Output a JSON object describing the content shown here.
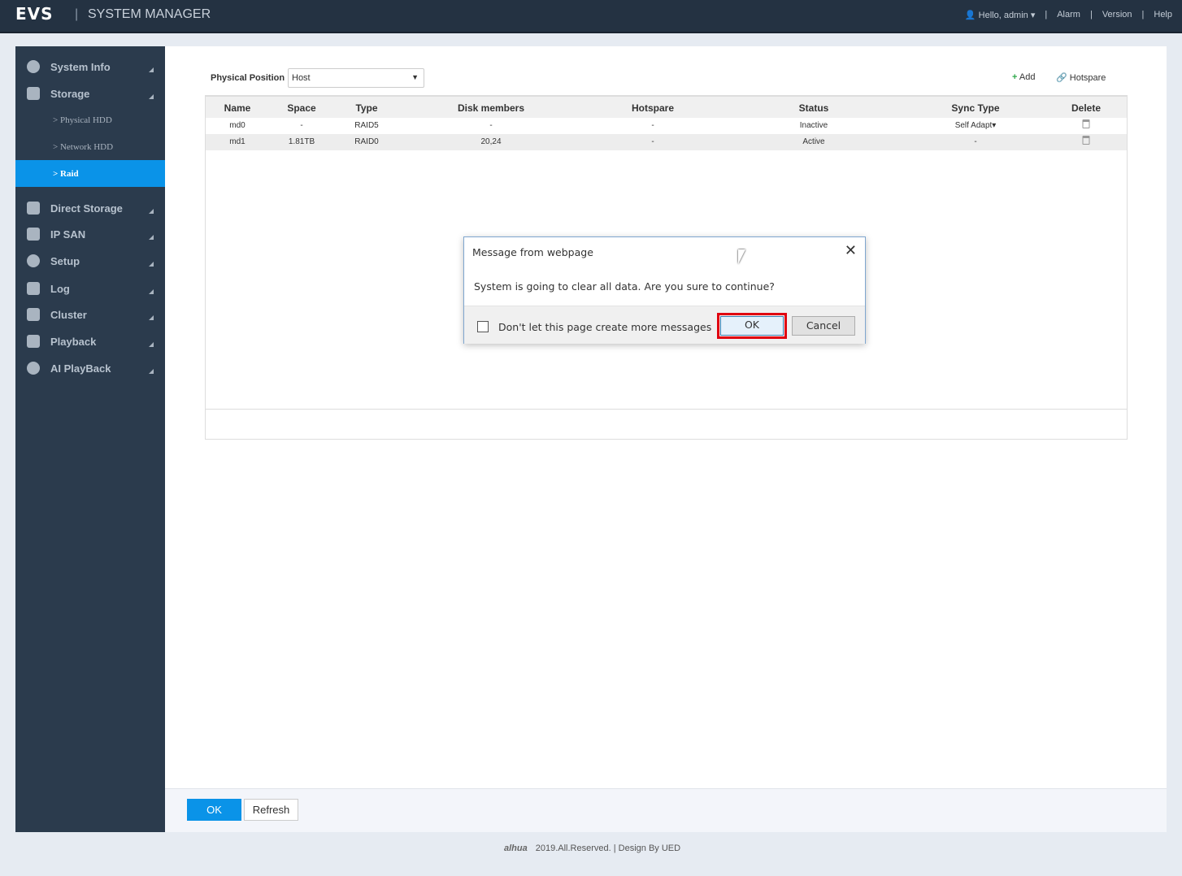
{
  "header": {
    "logo": "EVS",
    "title": "SYSTEM MANAGER",
    "user": "Hello, admin",
    "links": [
      "Alarm",
      "Version",
      "Help"
    ]
  },
  "sidebar": {
    "items": [
      {
        "label": "System Info",
        "icon": "pie-chart-icon"
      },
      {
        "label": "Storage",
        "icon": "floppy-icon"
      },
      {
        "label": "Direct Storage",
        "icon": "direct-storage-icon"
      },
      {
        "label": "IP SAN",
        "icon": "server-icon"
      },
      {
        "label": "Setup",
        "icon": "gear-icon"
      },
      {
        "label": "Log",
        "icon": "log-icon"
      },
      {
        "label": "Cluster",
        "icon": "cluster-icon"
      },
      {
        "label": "Playback",
        "icon": "playback-icon"
      },
      {
        "label": "AI PlayBack",
        "icon": "ai-playback-icon"
      }
    ],
    "subitems": [
      "> Physical HDD",
      "> Network HDD",
      "> Raid"
    ]
  },
  "filter": {
    "label": "Physical Position",
    "value": "Host"
  },
  "actions": {
    "add": "Add",
    "hotspare": "Hotspare"
  },
  "table": {
    "headers": [
      "Name",
      "Space",
      "Type",
      "Disk members",
      "Hotspare",
      "Status",
      "Sync Type",
      "Delete"
    ],
    "rows": [
      [
        "md0",
        "-",
        "RAID5",
        "-",
        "-",
        "Inactive",
        "Self Adapt"
      ],
      [
        "md1",
        "1.81TB",
        "RAID0",
        "20,24",
        "-",
        "Active",
        "-"
      ]
    ]
  },
  "buttons": {
    "ok": "OK",
    "refresh": "Refresh"
  },
  "footer": {
    "brand": "alhua",
    "text": "2019.All.Reserved. | Design By UED"
  },
  "dialog": {
    "title": "Message from webpage",
    "message": "System is going to clear all data. Are you sure to continue?",
    "checkbox": "Don't let this page create more messages",
    "ok": "OK",
    "cancel": "Cancel"
  }
}
